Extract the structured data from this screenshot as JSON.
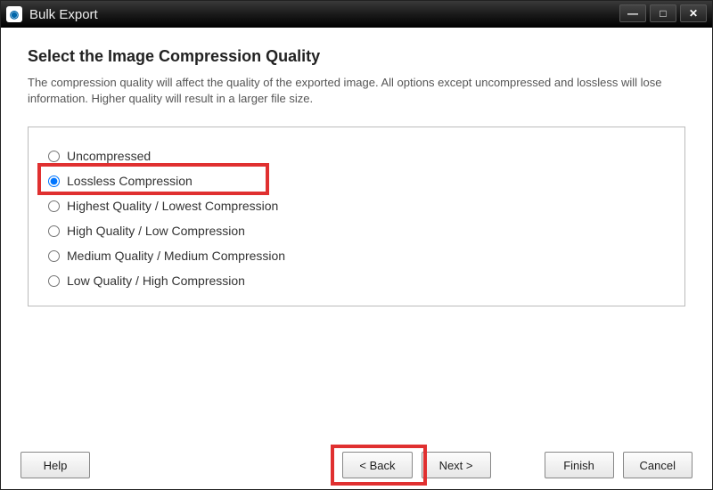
{
  "window": {
    "title": "Bulk Export"
  },
  "heading": "Select the Image Compression Quality",
  "description": "The compression quality will affect the quality of the exported image. All options except uncompressed and lossless will lose information. Higher quality will result in a larger file size.",
  "options": {
    "selected_index": 1,
    "items": [
      "Uncompressed",
      "Lossless Compression",
      "Highest Quality / Lowest Compression",
      "High Quality / Low Compression",
      "Medium Quality / Medium Compression",
      "Low Quality / High Compression"
    ]
  },
  "buttons": {
    "help": "Help",
    "back": "< Back",
    "next": "Next >",
    "finish": "Finish",
    "cancel": "Cancel"
  },
  "annotations": {
    "highlight_option_index": 1,
    "highlight_button": "next"
  }
}
